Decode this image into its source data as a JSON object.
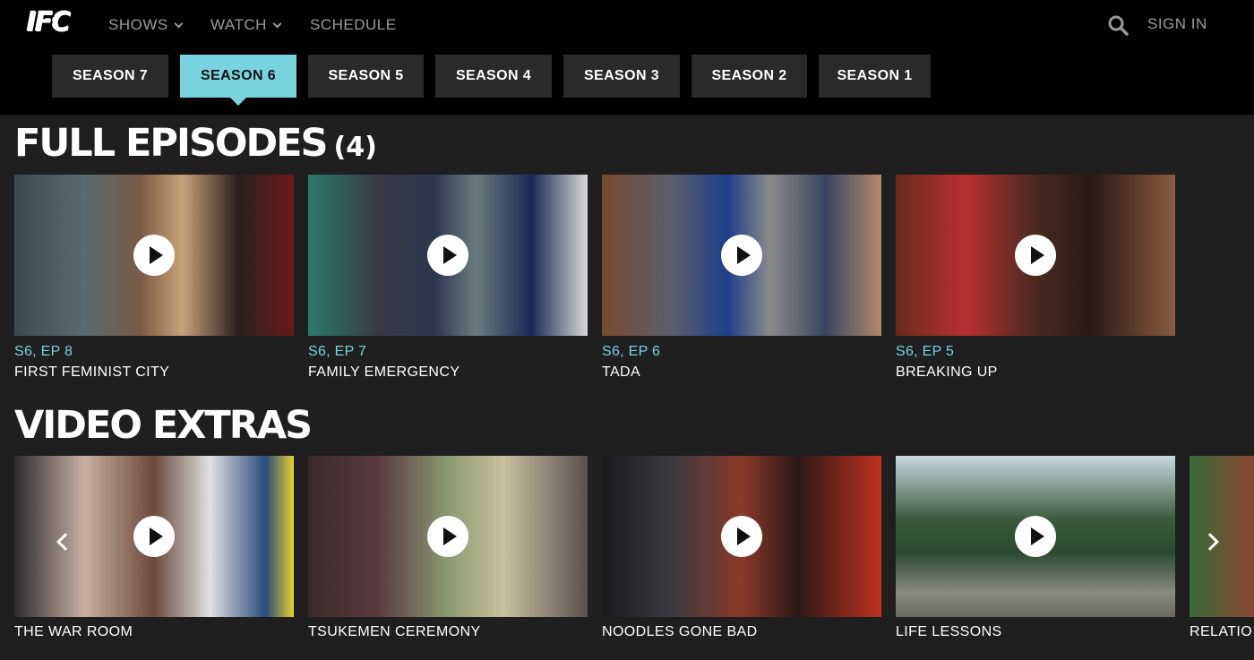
{
  "header": {
    "logo_text": "IFC",
    "nav": [
      {
        "label": "SHOWS",
        "has_dropdown": true
      },
      {
        "label": "WATCH",
        "has_dropdown": true
      },
      {
        "label": "SCHEDULE",
        "has_dropdown": false
      }
    ],
    "search_icon": "search-icon",
    "signin_label": "SIGN IN"
  },
  "seasons": {
    "items": [
      "SEASON 7",
      "SEASON 6",
      "SEASON 5",
      "SEASON 4",
      "SEASON 3",
      "SEASON 2",
      "SEASON 1"
    ],
    "selected": "SEASON 6"
  },
  "full_episodes": {
    "title": "FULL EPISODES",
    "count": "(4)",
    "items": [
      {
        "ep": "S6, EP 8",
        "title": "FIRST FEMINIST CITY"
      },
      {
        "ep": "S6, EP 7",
        "title": "FAMILY EMERGENCY"
      },
      {
        "ep": "S6, EP 6",
        "title": "TADA"
      },
      {
        "ep": "S6, EP 5",
        "title": "BREAKING UP"
      }
    ]
  },
  "video_extras": {
    "title": "VIDEO EXTRAS",
    "items": [
      {
        "title": "THE WAR ROOM"
      },
      {
        "title": "TSUKEMEN CEREMONY"
      },
      {
        "title": "NOODLES GONE BAD"
      },
      {
        "title": "LIFE LESSONS"
      },
      {
        "title": "RELATIO"
      }
    ]
  },
  "colors": {
    "accent": "#78d3de",
    "background": "#1f1f1f",
    "header": "#000000"
  }
}
